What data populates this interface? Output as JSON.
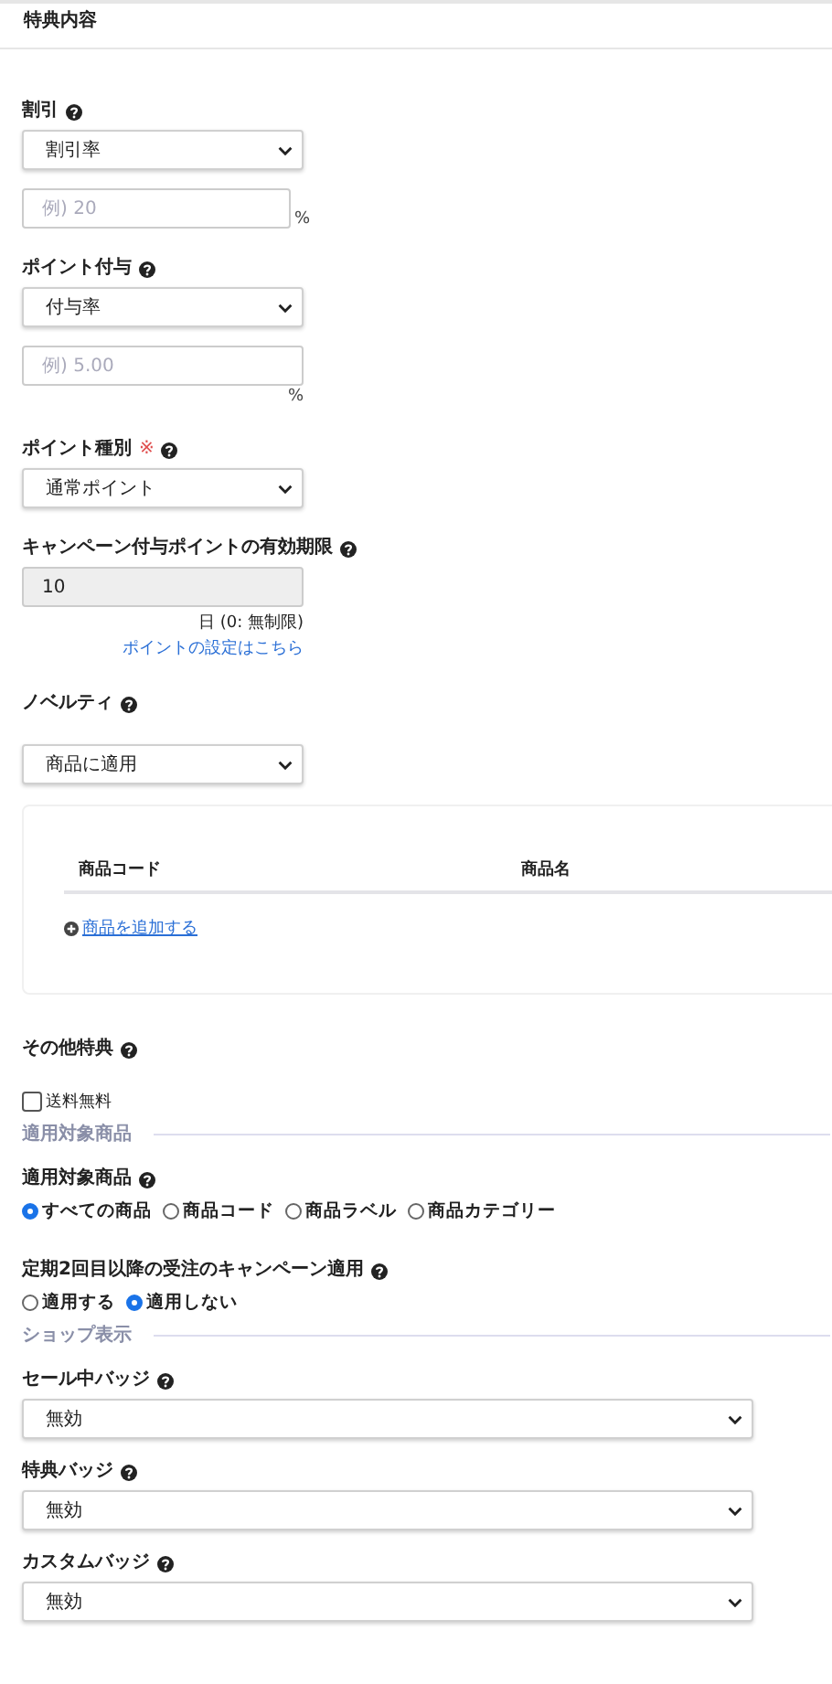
{
  "header": {
    "title": "特典内容"
  },
  "discount": {
    "label": "割引",
    "select": "割引率",
    "placeholder": "例) 20",
    "unit": "%"
  },
  "point_grant": {
    "label": "ポイント付与",
    "select": "付与率",
    "placeholder": "例) 5.00",
    "unit": "%"
  },
  "point_type": {
    "label": "ポイント種別",
    "required_mark": "※",
    "select": "通常ポイント"
  },
  "expiry": {
    "label": "キャンペーン付与ポイントの有効期限",
    "value": "10",
    "note": "日 (0: 無制限)",
    "link": "ポイントの設定はこちら"
  },
  "novelty": {
    "label": "ノベルティ",
    "select": "商品に適用",
    "table": {
      "columns": [
        "商品コード",
        "商品名"
      ],
      "add_link": "商品を追加する"
    }
  },
  "other": {
    "label": "その他特典",
    "checkboxes": [
      {
        "label": "送料無料",
        "checked": false
      }
    ]
  },
  "target_section": {
    "title": "適用対象商品"
  },
  "target": {
    "label": "適用対象商品",
    "options": [
      {
        "label": "すべての商品",
        "selected": true
      },
      {
        "label": "商品コード",
        "selected": false
      },
      {
        "label": "商品ラベル",
        "selected": false
      },
      {
        "label": "商品カテゴリー",
        "selected": false
      }
    ]
  },
  "subscription": {
    "label": "定期2回目以降の受注のキャンペーン適用",
    "options": [
      {
        "label": "適用する",
        "selected": false
      },
      {
        "label": "適用しない",
        "selected": true
      }
    ]
  },
  "shop_section": {
    "title": "ショップ表示"
  },
  "badges": [
    {
      "label": "セール中バッジ",
      "select": "無効"
    },
    {
      "label": "特典バッジ",
      "select": "無効"
    },
    {
      "label": "カスタムバッジ",
      "select": "無効"
    }
  ]
}
